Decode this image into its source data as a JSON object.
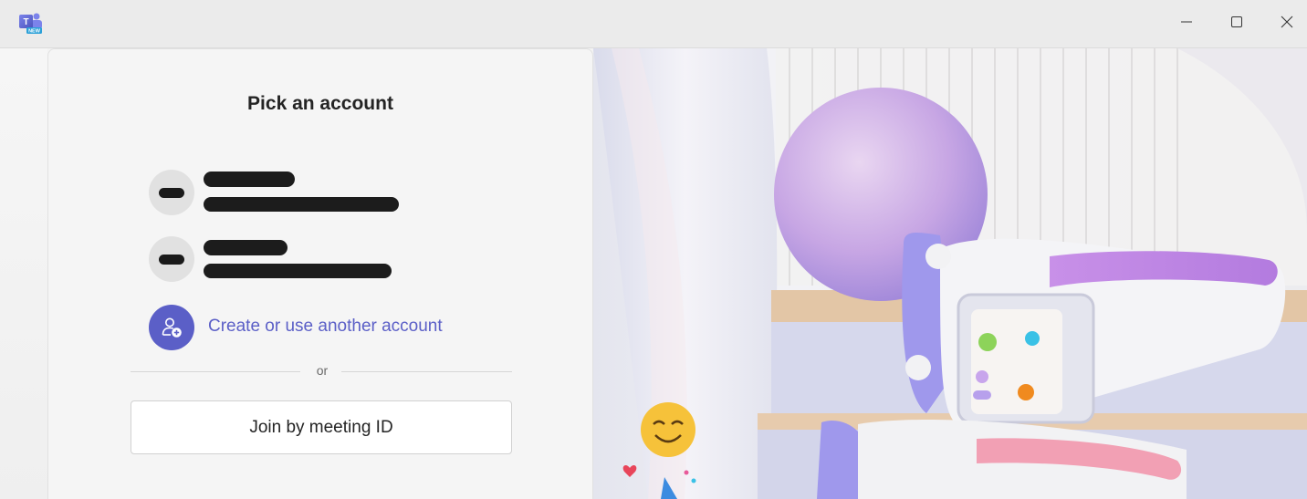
{
  "window": {
    "app_badge": "NEW",
    "controls": {
      "minimize": "minimize-icon",
      "maximize": "maximize-icon",
      "close": "close-icon"
    }
  },
  "account_picker": {
    "title": "Pick an account",
    "accounts": [
      {
        "avatar_icon": "redacted-initials"
      },
      {
        "avatar_icon": "redacted-initials"
      }
    ],
    "create_account_label": "Create or use another account",
    "divider_text": "or",
    "join_button_label": "Join by meeting ID"
  },
  "colors": {
    "accent": "#5b5fc7",
    "panel_bg": "#f5f5f5",
    "titlebar_bg": "#ebebeb"
  }
}
